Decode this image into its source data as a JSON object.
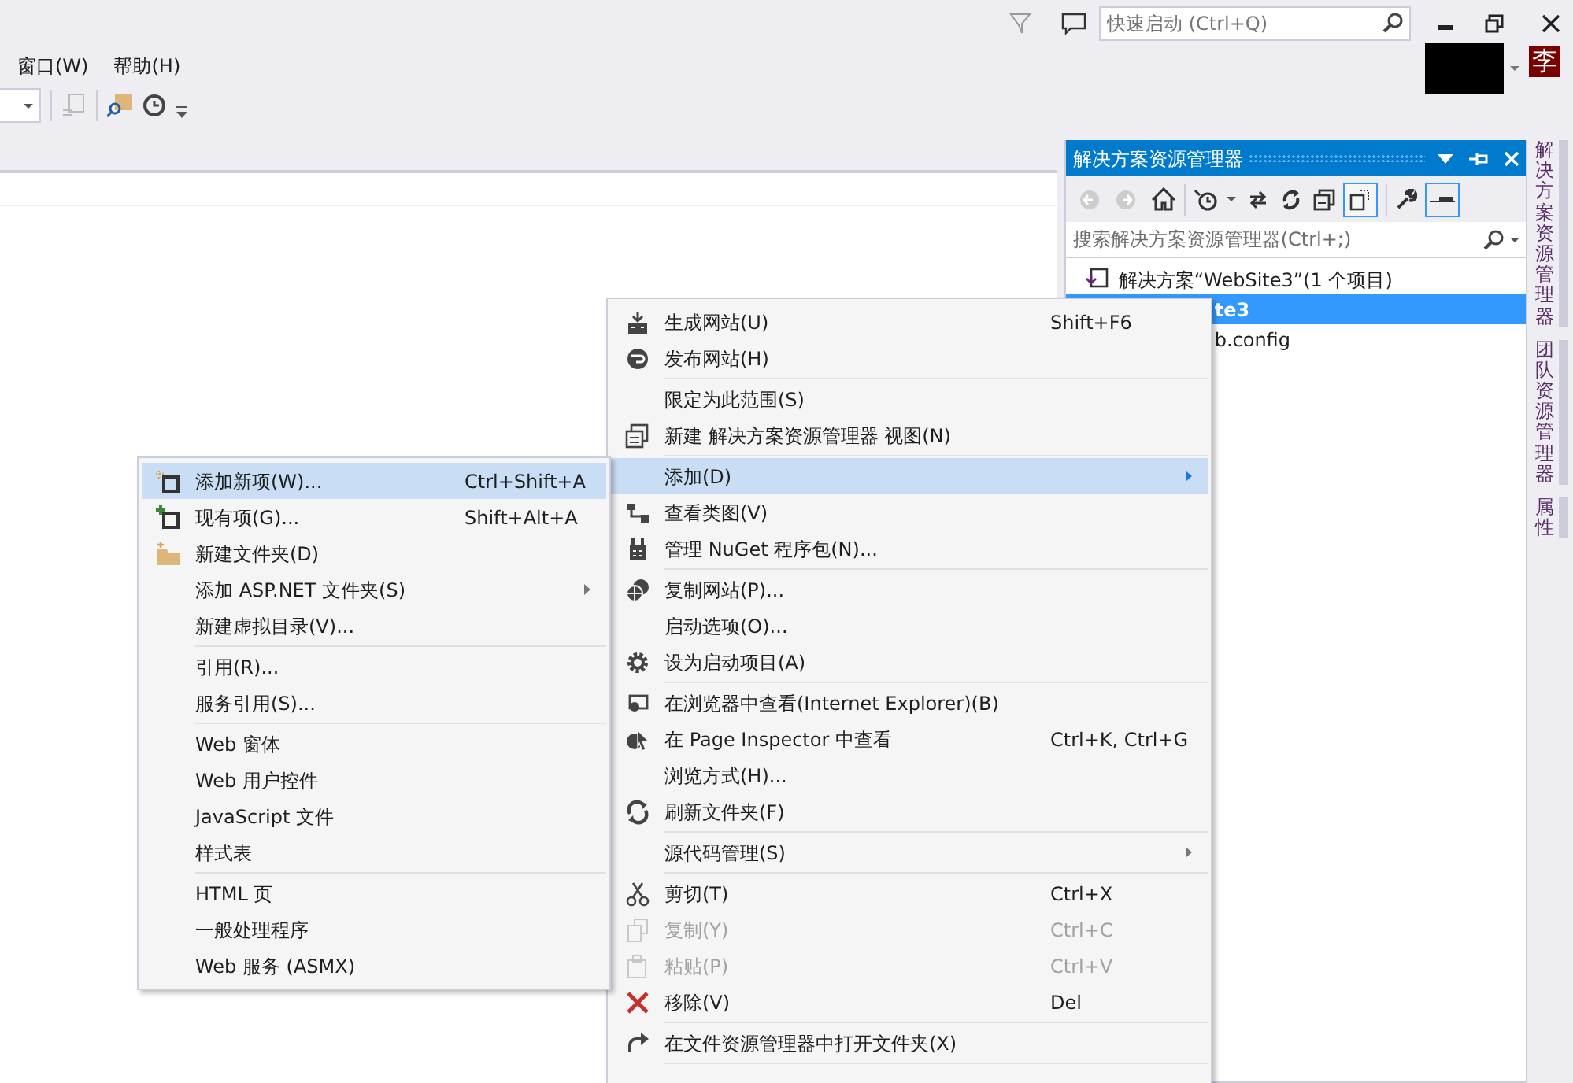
{
  "menu_bar": [
    {
      "label": "窗口(W)"
    },
    {
      "label": "帮助(H)"
    }
  ],
  "quick_launch": {
    "placeholder": "快速启动 (Ctrl+Q)"
  },
  "user_badge": "李",
  "solution_explorer": {
    "title": "解决方案资源管理器",
    "search": {
      "placeholder": "搜索解决方案资源管理器(Ctrl+;)"
    },
    "tree": [
      {
        "label": "解决方案“WebSite3”(1 个项目)",
        "selected": false,
        "children": [
          {
            "label": "te3",
            "selected": true,
            "children": [
              {
                "label": "b.config",
                "selected": false
              }
            ]
          }
        ]
      }
    ]
  },
  "side_tabs": [
    {
      "label": "解决方案资源管理器"
    },
    {
      "label": "团队资源管理器"
    },
    {
      "label": "属性"
    }
  ],
  "context_menu": {
    "items": [
      {
        "kind": "item",
        "label": "生成网站(U)",
        "shortcut": "Shift+F6",
        "submenu": false,
        "selected": false,
        "disabled": false
      },
      {
        "kind": "item",
        "label": "发布网站(H)",
        "submenu": false,
        "selected": false,
        "disabled": false
      },
      {
        "kind": "separator"
      },
      {
        "kind": "item",
        "label": "限定为此范围(S)",
        "submenu": false,
        "selected": false,
        "disabled": false
      },
      {
        "kind": "item",
        "label": "新建 解决方案资源管理器 视图(N)",
        "submenu": false,
        "selected": false,
        "disabled": false
      },
      {
        "kind": "separator"
      },
      {
        "kind": "item",
        "label": "添加(D)",
        "submenu": true,
        "selected": true,
        "disabled": false
      },
      {
        "kind": "item",
        "label": "查看类图(V)",
        "submenu": false,
        "selected": false,
        "disabled": false
      },
      {
        "kind": "item",
        "label": "管理 NuGet 程序包(N)...",
        "submenu": false,
        "selected": false,
        "disabled": false
      },
      {
        "kind": "separator"
      },
      {
        "kind": "item",
        "label": "复制网站(P)...",
        "submenu": false,
        "selected": false,
        "disabled": false
      },
      {
        "kind": "item",
        "label": "启动选项(O)...",
        "submenu": false,
        "selected": false,
        "disabled": false
      },
      {
        "kind": "item",
        "label": "设为启动项目(A)",
        "submenu": false,
        "selected": false,
        "disabled": false
      },
      {
        "kind": "separator"
      },
      {
        "kind": "item",
        "label": "在浏览器中查看(Internet Explorer)(B)",
        "submenu": false,
        "selected": false,
        "disabled": false
      },
      {
        "kind": "item",
        "label": "在 Page Inspector 中查看",
        "shortcut": "Ctrl+K, Ctrl+G",
        "submenu": false,
        "selected": false,
        "disabled": false
      },
      {
        "kind": "item",
        "label": "浏览方式(H)...",
        "submenu": false,
        "selected": false,
        "disabled": false
      },
      {
        "kind": "item",
        "label": "刷新文件夹(F)",
        "submenu": false,
        "selected": false,
        "disabled": false
      },
      {
        "kind": "separator"
      },
      {
        "kind": "item",
        "label": "源代码管理(S)",
        "submenu": true,
        "selected": false,
        "disabled": false
      },
      {
        "kind": "separator"
      },
      {
        "kind": "item",
        "label": "剪切(T)",
        "shortcut": "Ctrl+X",
        "submenu": false,
        "selected": false,
        "disabled": false
      },
      {
        "kind": "item",
        "label": "复制(Y)",
        "shortcut": "Ctrl+C",
        "submenu": false,
        "selected": false,
        "disabled": true
      },
      {
        "kind": "item",
        "label": "粘贴(P)",
        "shortcut": "Ctrl+V",
        "submenu": false,
        "selected": false,
        "disabled": true
      },
      {
        "kind": "item",
        "label": "移除(V)",
        "shortcut": "Del",
        "submenu": false,
        "selected": false,
        "disabled": false
      },
      {
        "kind": "separator"
      },
      {
        "kind": "item",
        "label": "在文件资源管理器中打开文件夹(X)",
        "submenu": false,
        "selected": false,
        "disabled": false
      },
      {
        "kind": "separator"
      }
    ]
  },
  "add_submenu": {
    "items": [
      {
        "kind": "item",
        "label": "添加新项(W)...",
        "shortcut": "Ctrl+Shift+A",
        "submenu": false,
        "selected": true
      },
      {
        "kind": "item",
        "label": "现有项(G)...",
        "shortcut": "Shift+Alt+A",
        "submenu": false,
        "selected": false
      },
      {
        "kind": "item",
        "label": "新建文件夹(D)",
        "submenu": false,
        "selected": false
      },
      {
        "kind": "item",
        "label": "添加 ASP.NET 文件夹(S)",
        "submenu": true,
        "selected": false
      },
      {
        "kind": "item",
        "label": "新建虚拟目录(V)...",
        "submenu": false,
        "selected": false
      },
      {
        "kind": "separator"
      },
      {
        "kind": "item",
        "label": "引用(R)...",
        "submenu": false,
        "selected": false
      },
      {
        "kind": "item",
        "label": "服务引用(S)...",
        "submenu": false,
        "selected": false
      },
      {
        "kind": "separator"
      },
      {
        "kind": "item",
        "label": "Web 窗体",
        "submenu": false,
        "selected": false
      },
      {
        "kind": "item",
        "label": "Web 用户控件",
        "submenu": false,
        "selected": false
      },
      {
        "kind": "item",
        "label": "JavaScript 文件",
        "submenu": false,
        "selected": false
      },
      {
        "kind": "item",
        "label": "样式表",
        "submenu": false,
        "selected": false
      },
      {
        "kind": "separator"
      },
      {
        "kind": "item",
        "label": "HTML 页",
        "submenu": false,
        "selected": false
      },
      {
        "kind": "item",
        "label": "一般处理程序",
        "submenu": false,
        "selected": false
      },
      {
        "kind": "item",
        "label": "Web 服务 (ASMX)",
        "submenu": false,
        "selected": false
      }
    ]
  }
}
